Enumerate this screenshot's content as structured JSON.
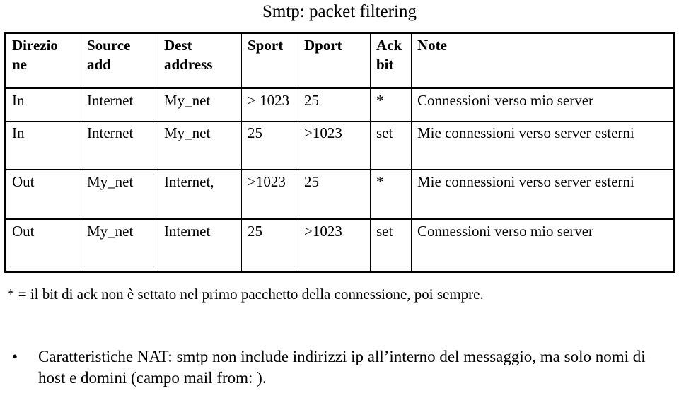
{
  "slide": {
    "title": "Smtp: packet filtering"
  },
  "table": {
    "headers": [
      {
        "lines": [
          "Direzio",
          "ne"
        ]
      },
      {
        "lines": [
          "Source",
          "add"
        ]
      },
      {
        "lines": [
          "Dest",
          "address"
        ]
      },
      {
        "lines": [
          "Sport",
          ""
        ]
      },
      {
        "lines": [
          "Dport",
          ""
        ]
      },
      {
        "lines": [
          "Ack",
          "bit"
        ]
      },
      {
        "lines": [
          "Note",
          ""
        ]
      }
    ],
    "rows": [
      {
        "direzione": "In",
        "source_add": "Internet",
        "dest_address": "My_net",
        "sport": "> 1023",
        "dport": "25",
        "ack_bit": "*",
        "note": "Connessioni verso mio server"
      },
      {
        "direzione": "In",
        "source_add": "Internet",
        "dest_address": "My_net",
        "sport": "25",
        "dport": ">1023",
        "ack_bit": "set",
        "note": "Mie connessioni verso server esterni"
      },
      {
        "direzione": "Out",
        "source_add": "My_net",
        "dest_address": "Internet,",
        "sport": ">1023",
        "dport": "25",
        "ack_bit": "*",
        "note": "Mie connessioni verso server esterni"
      },
      {
        "direzione": "Out",
        "source_add": "My_net",
        "dest_address": "Internet",
        "sport": "25",
        "dport": ">1023",
        "ack_bit": "set",
        "note": "Connessioni verso mio server"
      }
    ]
  },
  "footnote": {
    "text": "* = il bit di ack non è settato nel primo pacchetto della connessione, poi sempre."
  },
  "bullets": {
    "marker": "•",
    "items": [
      "Caratteristiche NAT: smtp non include indirizzi ip all’interno del messaggio, ma solo nomi di host e domini (campo mail from: )."
    ]
  }
}
